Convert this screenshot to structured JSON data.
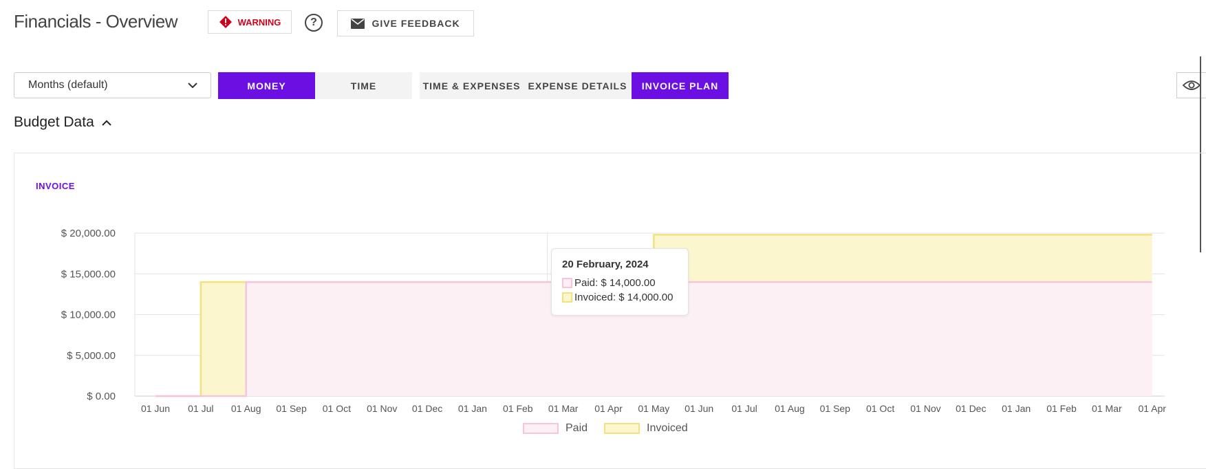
{
  "header": {
    "title": "Financials - Overview",
    "warning_label": "WARNING",
    "help_label": "?",
    "feedback_label": "GIVE FEEDBACK"
  },
  "toolbar": {
    "period_select": {
      "selected": "Months (default)"
    },
    "view_tabs": [
      {
        "label": "MONEY",
        "active": true
      },
      {
        "label": "TIME",
        "active": false
      }
    ],
    "detail_tabs": [
      {
        "label": "TIME & EXPENSES",
        "active": false
      },
      {
        "label": "EXPENSE DETAILS",
        "active": false
      },
      {
        "label": "INVOICE PLAN",
        "active": true
      }
    ]
  },
  "section": {
    "title": "Budget Data",
    "card_label": "INVOICE"
  },
  "colors": {
    "accent": "#6b0fe3",
    "warning": "#d0021b",
    "paid_line": "#f7c4dd",
    "paid_fill": "#fdf0f5",
    "invoiced_line": "#f1e27e",
    "invoiced_fill": "#fcf6cf"
  },
  "tooltip": {
    "date": "20 February, 2024",
    "rows": [
      {
        "label": "Paid: $ 14,000.00"
      },
      {
        "label": "Invoiced: $ 14,000.00"
      }
    ]
  },
  "chart_data": {
    "type": "area",
    "title": "",
    "xlabel": "",
    "ylabel": "",
    "ylim": [
      0,
      20000
    ],
    "y_ticks": [
      0,
      5000,
      10000,
      15000,
      20000
    ],
    "y_tick_labels": [
      "$ 0.00",
      "$ 5,000.00",
      "$ 10,000.00",
      "$ 15,000.00",
      "$ 20,000.00"
    ],
    "x_tick_labels": [
      "01 Jun",
      "01 Jul",
      "01 Aug",
      "01 Sep",
      "01 Oct",
      "01 Nov",
      "01 Dec",
      "01 Jan",
      "01 Feb",
      "01 Mar",
      "01 Apr",
      "01 May",
      "01 Jun",
      "01 Jul",
      "01 Aug",
      "01 Sep",
      "01 Oct",
      "01 Nov",
      "01 Dec",
      "01 Jan",
      "01 Feb",
      "01 Mar",
      "01 Apr"
    ],
    "grid": true,
    "legend_position": "bottom-center",
    "series": [
      {
        "name": "Invoiced",
        "points": [
          [
            0,
            0
          ],
          [
            1.0,
            0
          ],
          [
            1.0,
            14000
          ],
          [
            2.0,
            14000
          ],
          [
            11.0,
            14000
          ],
          [
            11.0,
            19800
          ],
          [
            22.0,
            19800
          ]
        ]
      },
      {
        "name": "Paid",
        "points": [
          [
            0,
            0
          ],
          [
            2.0,
            0
          ],
          [
            2.0,
            14000
          ],
          [
            22.0,
            14000
          ]
        ]
      }
    ],
    "hover_x": 8.65
  }
}
